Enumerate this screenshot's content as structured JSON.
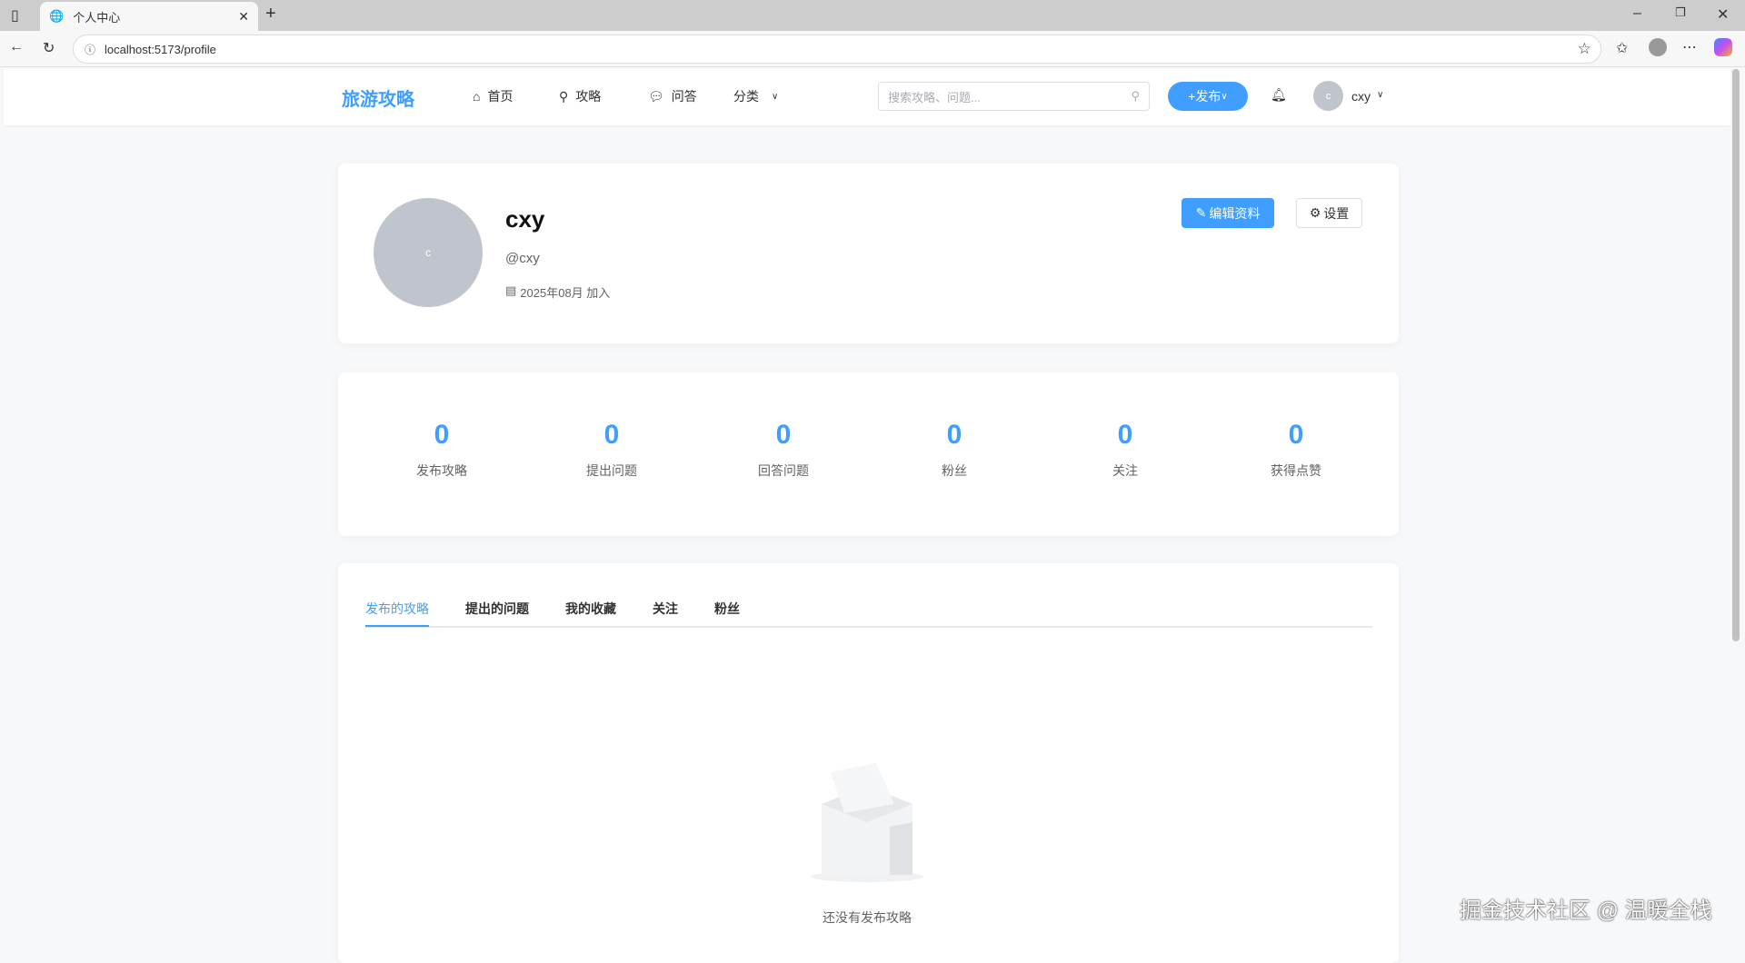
{
  "browser": {
    "tab_title": "个人中心",
    "url": "localhost:5173/profile"
  },
  "header": {
    "logo": "旅游攻略",
    "nav": [
      {
        "label": "首页",
        "icon": "home-icon"
      },
      {
        "label": "攻略",
        "icon": "map-pin-icon"
      },
      {
        "label": "问答",
        "icon": "chat-icon"
      },
      {
        "label": "分类",
        "icon": "chevron-down-icon"
      }
    ],
    "search_placeholder": "搜索攻略、问题...",
    "publish_label": "+发布",
    "user_initial": "c",
    "username": "cxy"
  },
  "profile": {
    "avatar_initial": "c",
    "name": "cxy",
    "handle": "@cxy",
    "joined": "2025年08月 加入",
    "edit_label": "编辑资料",
    "settings_label": "设置"
  },
  "stats": [
    {
      "value": "0",
      "label": "发布攻略"
    },
    {
      "value": "0",
      "label": "提出问题"
    },
    {
      "value": "0",
      "label": "回答问题"
    },
    {
      "value": "0",
      "label": "粉丝"
    },
    {
      "value": "0",
      "label": "关注"
    },
    {
      "value": "0",
      "label": "获得点赞"
    }
  ],
  "tabs": [
    {
      "label": "发布的攻略",
      "active": true
    },
    {
      "label": "提出的问题"
    },
    {
      "label": "我的收藏"
    },
    {
      "label": "关注"
    },
    {
      "label": "粉丝"
    }
  ],
  "empty_text": "还没有发布攻略",
  "watermark": "掘金技术社区 @ 温暖全栈",
  "colors": {
    "accent": "#409eff"
  }
}
